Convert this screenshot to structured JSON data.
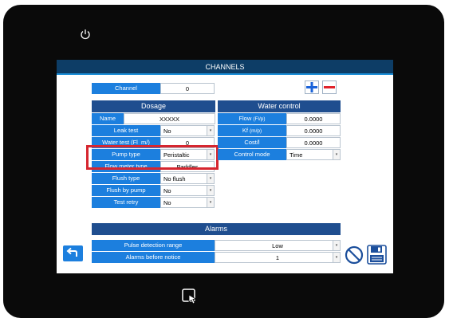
{
  "screen": {
    "title": "CHANNELS"
  },
  "channel": {
    "label": "Channel",
    "value": "0"
  },
  "dosage": {
    "header": "Dosage",
    "name_label": "Name",
    "name_value": "XXXXX",
    "rows": [
      {
        "label": "Leak test",
        "value": "No"
      },
      {
        "label": "Water test (Fl_m/)",
        "value": "0"
      },
      {
        "label": "Pump type",
        "value": "Peristaltic"
      },
      {
        "label": "Flow meter type",
        "value": "Paddles"
      },
      {
        "label": "Flush type",
        "value": "No flush"
      },
      {
        "label": "Flush by pump",
        "value": "No"
      },
      {
        "label": "Test retry",
        "value": "No"
      }
    ]
  },
  "water_control": {
    "header": "Water control",
    "rows": [
      {
        "label": "Flow",
        "unit": "(Fl/p)",
        "value": "0.0000"
      },
      {
        "label": "Kf",
        "unit": "(m/p)",
        "value": "0.0000"
      },
      {
        "label": "Cost/l",
        "unit": "",
        "value": "0.0000"
      }
    ],
    "control_mode_label": "Control mode",
    "control_mode_value": "Time"
  },
  "alarms": {
    "header": "Alarms",
    "rows": [
      {
        "label": "Pulse detection range",
        "value": "Low"
      },
      {
        "label": "Alarms before notice",
        "value": "1"
      }
    ]
  },
  "colors": {
    "title_bar": "#0d3d66",
    "label_blue": "#1c7fde",
    "header_navy": "#1f4e8f",
    "highlight": "#d6262f",
    "bezel": "#0a0a0a"
  },
  "icons": [
    "power-icon",
    "plus-icon",
    "minus-icon",
    "back-icon",
    "cancel-icon",
    "save-icon",
    "tap-icon"
  ]
}
